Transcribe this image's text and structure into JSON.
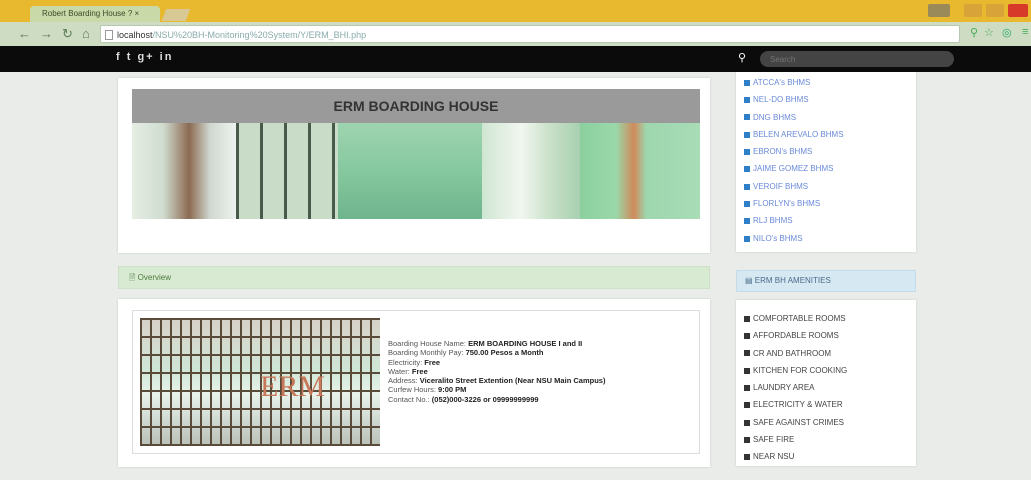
{
  "browser": {
    "tab_title": "Robert Boarding House ? ×",
    "address_host": "localhost",
    "address_path": "/NSU%20BH-Monitoring%20System/Y/ERM_BHI.php"
  },
  "search": {
    "placeholder": "Search"
  },
  "social": {
    "icons": "f t g+ in"
  },
  "header": {
    "title": "ERM BOARDING HOUSE"
  },
  "sidebar": {
    "links": [
      "ATCCA's BHMS",
      "NEL-DO BHMS",
      "DNG BHMS",
      "BELEN AREVALO BHMS",
      "EBRON's BHMS",
      "JAIME GOMEZ BHMS",
      "VEROIF BHMS",
      "FLORLYN's BHMS",
      "RLJ BHMS",
      "NILO's BHMS"
    ]
  },
  "overview": {
    "label": "Overview"
  },
  "amenities_head": {
    "label": "ERM BH AMENITIES"
  },
  "details": {
    "name_label": "Boarding House Name:",
    "name_value": "ERM BOARDING HOUSE I and II",
    "pay_label": "Boarding Monthly Pay:",
    "pay_value": "750.00 Pesos a Month",
    "electricity_label": "Electricity:",
    "electricity_value": "Free",
    "water_label": "Water:",
    "water_value": "Free",
    "address_label": "Address:",
    "address_value": "Viceralito Street Extention (Near NSU Main Campus)",
    "curfew_label": "Curfew Hours:",
    "curfew_value": "9:00 PM",
    "contact_label": "Contact No.:",
    "contact_value": "(052)000-3226 or 09999999999"
  },
  "photo_text": {
    "erm": "ERM"
  },
  "amenities": [
    "COMFORTABLE ROOMS",
    "AFFORDABLE ROOMS",
    "CR AND BATHROOM",
    "KITCHEN FOR COOKING",
    "LAUNDRY AREA",
    "ELECTRICITY & WATER",
    "SAFE AGAINST CRIMES",
    "SAFE FIRE",
    "NEAR NSU"
  ],
  "colors": {
    "link_square": "#2f7fc8",
    "accent_green": "#d9ead3",
    "accent_blue": "#d6e9f3"
  }
}
